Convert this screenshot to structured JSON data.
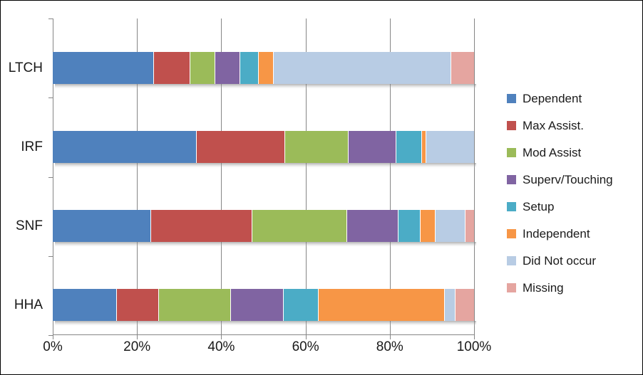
{
  "chart_data": {
    "type": "bar",
    "orientation": "horizontal",
    "stacked": true,
    "stack_mode": "percent",
    "title": "",
    "xlabel": "",
    "ylabel": "",
    "xlim": [
      0,
      100
    ],
    "xtick_labels": [
      "0%",
      "20%",
      "40%",
      "60%",
      "80%",
      "100%"
    ],
    "xtick_values": [
      0,
      20,
      40,
      60,
      80,
      100
    ],
    "grid": true,
    "grid_axis": "x",
    "legend_position": "right",
    "categories": [
      "LTCH",
      "IRF",
      "SNF",
      "HHA"
    ],
    "category_order_top_to_bottom": [
      "LTCH",
      "IRF",
      "SNF",
      "HHA"
    ],
    "series": [
      {
        "name": "Dependent",
        "color": "#4F81BD",
        "values": [
          24.1,
          34.1,
          23.4,
          15.3
        ]
      },
      {
        "name": "Max Assist.",
        "color": "#C0504D",
        "values": [
          8.5,
          21.0,
          24.0,
          9.9
        ]
      },
      {
        "name": "Mod Assist",
        "color": "#9BBB59",
        "values": [
          6.0,
          15.1,
          22.5,
          17.1
        ]
      },
      {
        "name": "Superv/Touching",
        "color": "#8064A2",
        "values": [
          5.9,
          11.3,
          12.2,
          12.6
        ]
      },
      {
        "name": "Setup",
        "color": "#4BACC6",
        "values": [
          4.4,
          6.2,
          5.2,
          8.2
        ]
      },
      {
        "name": "Independent",
        "color": "#F79646",
        "values": [
          3.5,
          0.9,
          3.6,
          30.0
        ]
      },
      {
        "name": "Did Not occur",
        "color": "#B8CCE4",
        "values": [
          42.2,
          11.4,
          7.0,
          2.5
        ]
      },
      {
        "name": "Missing",
        "color": "#E5A5A0",
        "values": [
          5.4,
          0.0,
          2.1,
          4.4
        ]
      }
    ]
  },
  "legend": {
    "items": [
      {
        "label": "Dependent",
        "color": "#4F81BD",
        "swatch_name": "legend-swatch-dependent"
      },
      {
        "label": "Max Assist.",
        "color": "#C0504D",
        "swatch_name": "legend-swatch-max-assist"
      },
      {
        "label": "Mod Assist",
        "color": "#9BBB59",
        "swatch_name": "legend-swatch-mod-assist"
      },
      {
        "label": "Superv/Touching",
        "color": "#8064A2",
        "swatch_name": "legend-swatch-superv-touching"
      },
      {
        "label": "Setup",
        "color": "#4BACC6",
        "swatch_name": "legend-swatch-setup"
      },
      {
        "label": "Independent",
        "color": "#F79646",
        "swatch_name": "legend-swatch-independent"
      },
      {
        "label": "Did Not occur",
        "color": "#B8CCE4",
        "swatch_name": "legend-swatch-did-not-occur"
      },
      {
        "label": "Missing",
        "color": "#E5A5A0",
        "swatch_name": "legend-swatch-missing"
      }
    ]
  },
  "axes": {
    "x_tick_labels": [
      "0%",
      "20%",
      "40%",
      "60%",
      "80%",
      "100%"
    ],
    "y_tick_labels": [
      "LTCH",
      "IRF",
      "SNF",
      "HHA"
    ]
  },
  "colors": {
    "axis": "#868686",
    "border": "#000000",
    "background": "#FFFFFF",
    "text": "#1A1A1A"
  }
}
